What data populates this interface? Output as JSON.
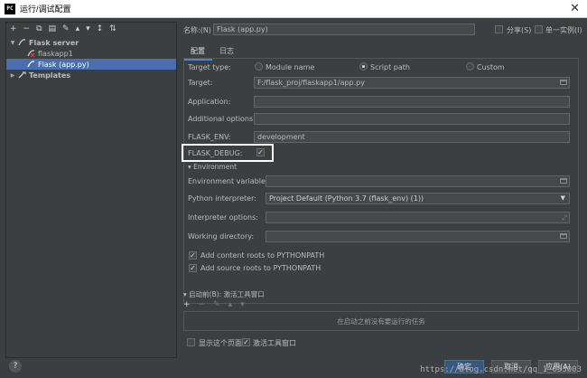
{
  "window": {
    "title": "运行/调试配置",
    "app_icon": "PC"
  },
  "left_toolbar": {
    "icons": [
      "+",
      "−",
      "⧉",
      "▤",
      "✎",
      "▴",
      "▾",
      "↕",
      "⇅"
    ]
  },
  "tree": {
    "group": "Flask server",
    "items": [
      "flaskapp1",
      "Flask (app.py)"
    ],
    "templates": "Templates"
  },
  "header": {
    "name_label": "名称:(N)",
    "name_value": "Flask (app.py)",
    "share_label": "分享(S)",
    "single_instance_label": "单一实例(I)"
  },
  "tabs": [
    "配置",
    "日志"
  ],
  "config": {
    "target_type_label": "Target type:",
    "target_type_options": [
      "Module name",
      "Script path",
      "Custom"
    ],
    "target_label": "Target:",
    "target_value": "F:/flask_proj/flaskapp1/app.py",
    "application_label": "Application:",
    "additional_options_label": "Additional options:",
    "flask_env_label": "FLASK_ENV:",
    "flask_env_value": "development",
    "flask_debug_label": "FLASK_DEBUG:",
    "environment_section": "Environment",
    "env_vars_label": "Environment variables:",
    "python_interpreter_label": "Python interpreter:",
    "python_interpreter_value": "Project Default (Python 3.7 (flask_env) (1))",
    "interpreter_options_label": "Interpreter options:",
    "working_directory_label": "Working directory:",
    "add_content_roots": "Add content roots to PYTHONPATH",
    "add_source_roots": "Add source roots to PYTHONPATH"
  },
  "before_launch": {
    "title": "启动前(B): 激活工具窗口",
    "empty_text": "在启动之前没有要运行的任务",
    "show_page": "显示这个页面",
    "activate_tool_window": "激活工具窗口"
  },
  "buttons": {
    "ok": "确定",
    "cancel": "取消",
    "apply": "应用(A)",
    "help": "?"
  },
  "watermark": "https://blog.csdn.net/qq_1_053003"
}
